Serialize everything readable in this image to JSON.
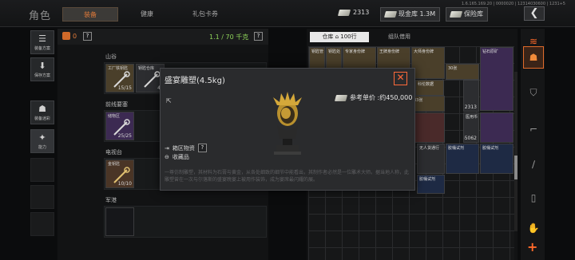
{
  "header": {
    "title": "角色",
    "tabs": [
      {
        "label": "装备",
        "active": true
      },
      {
        "label": "健康",
        "active": false
      },
      {
        "label": "礼包卡券",
        "active": false
      }
    ],
    "sysinfo": "1.6.165.169.20 | 0000020 | 12314030600 | 1231+5",
    "cash_amount": "2313",
    "cash_vault_label": "现金库 1.3M",
    "safe_label": "保险库",
    "back_icon": "chevron-left-icon"
  },
  "sidebar": {
    "buttons": [
      {
        "label": "装备方案",
        "icon": "loadout-icon"
      },
      {
        "label": "保存方案",
        "icon": "save-icon"
      },
      {
        "label": "装备迷彩",
        "icon": "helmet-icon"
      },
      {
        "label": "能力",
        "icon": "ability-icon"
      }
    ]
  },
  "equipment": {
    "bag_count": "0",
    "help": "?",
    "weight": "1.1 / 70 千克",
    "sections": [
      {
        "label": "山谷",
        "items": [
          {
            "name": "工厂铁钥匙",
            "count": "15/15"
          },
          {
            "name": "钥匙仓库",
            "count": "4/"
          }
        ]
      },
      {
        "label": "前线要塞",
        "items": [
          {
            "name": "储物区",
            "count": "25/25"
          }
        ]
      },
      {
        "label": "电视台",
        "items": [
          {
            "name": "金钥匙",
            "count": "10/10"
          }
        ]
      },
      {
        "label": "军港",
        "items": []
      }
    ]
  },
  "stash": {
    "tab_label": "仓库",
    "tab_count": "100行",
    "tab2_label": "组队借用",
    "items": [
      {
        "name": "钥匙管",
        "count": ""
      },
      {
        "name": "钥匙处",
        "count": ""
      },
      {
        "name": "专家身份牌",
        "count": ""
      },
      {
        "name": "王牌身份牌",
        "count": ""
      },
      {
        "name": "大师身份牌",
        "count": ""
      },
      {
        "name": "钻石原矿",
        "count": ""
      },
      {
        "name": "科伦数据",
        "count": ""
      },
      {
        "name": "33张",
        "count": ""
      },
      {
        "name": "30张",
        "count": ""
      },
      {
        "name": "狗狗币",
        "count": "2313"
      },
      {
        "name": "医用币",
        "count": "65062"
      },
      {
        "name": "胶桶试剂",
        "count": ""
      },
      {
        "name": "无人货通行",
        "count": ""
      },
      {
        "name": "胶桶试剂",
        "count": ""
      },
      {
        "name": "胶桶试剂",
        "count": ""
      }
    ]
  },
  "popup": {
    "title": "盛宴雕塑(4.5kg)",
    "price_label": "参考单价 :约450,000",
    "area_label": "箱区物资",
    "collect_label": "收藏品",
    "description": "一尊仿制雕塑，其材料为石膏与黄金，从各处细致的细节中能看出，其制作者必然是一位雕术大师。据当地人称，此雕塑曾在一次与尔落斯的盛宴晚宴上被用作装饰，成为宴席最闪耀的展。",
    "close_icon": "close-icon"
  },
  "rail": {
    "icons": [
      "collapse-icon",
      "helmet-icon",
      "body-armor-icon",
      "rifle-icon",
      "knife-icon",
      "bottle-icon",
      "hand-icon"
    ],
    "add_label": "+"
  },
  "colors": {
    "accent": "#e07a3a",
    "weight_green": "#8fd45a",
    "close_red": "#ff6a3a"
  }
}
